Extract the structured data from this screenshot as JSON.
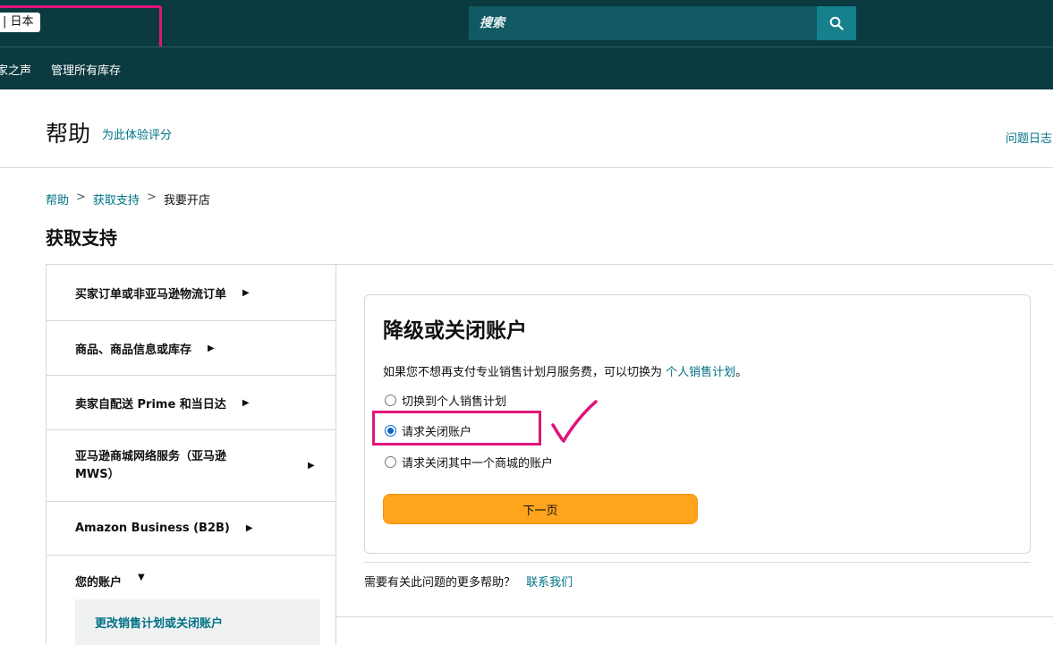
{
  "topbar": {
    "marketplace_label": "| 日本",
    "search_placeholder": "搜索"
  },
  "nav": {
    "items": [
      {
        "label": "家之声"
      },
      {
        "label": "管理所有库存"
      }
    ]
  },
  "help_header": {
    "title": "帮助",
    "rate_link": "为此体验评分",
    "issue_log": "问题日志"
  },
  "breadcrumb": {
    "items": [
      "帮助",
      "获取支持",
      "我要开店"
    ],
    "separator": ">"
  },
  "page_title": "获取支持",
  "sidebar": {
    "items": [
      {
        "label": "买家订单或非亚马逊物流订单",
        "arrow": "▶"
      },
      {
        "label": "商品、商品信息或库存",
        "arrow": "▶"
      },
      {
        "label": "卖家自配送 Prime 和当日达",
        "arrow": "▶"
      },
      {
        "label": "亚马逊商城网络服务（亚马逊MWS）",
        "arrow": "▶"
      },
      {
        "label": "Amazon Business (B2B)",
        "arrow": "▶"
      },
      {
        "label": "您的账户",
        "arrow": "▼"
      }
    ],
    "sub_item": "更改销售计划或关闭账户"
  },
  "card": {
    "title": "降级或关闭账户",
    "description": "如果您不想再支付专业销售计划月服务费，可以切换为",
    "description_link": "个人销售计划",
    "description_end": "。",
    "options": [
      {
        "label": "切换到个人销售计划",
        "checked": false
      },
      {
        "label": "请求关闭账户",
        "checked": true
      },
      {
        "label": "请求关闭其中一个商城的账户",
        "checked": false
      }
    ],
    "next_button": "下一页"
  },
  "more_help": {
    "text": "需要有关此问题的更多帮助？",
    "link": "联系我们"
  },
  "colors": {
    "topbar": "#0b3a40",
    "search_bg": "#125a63",
    "search_button": "#16818c",
    "link": "#007185",
    "primary_button": "#ffa41c",
    "annotation": "#e0157a"
  }
}
